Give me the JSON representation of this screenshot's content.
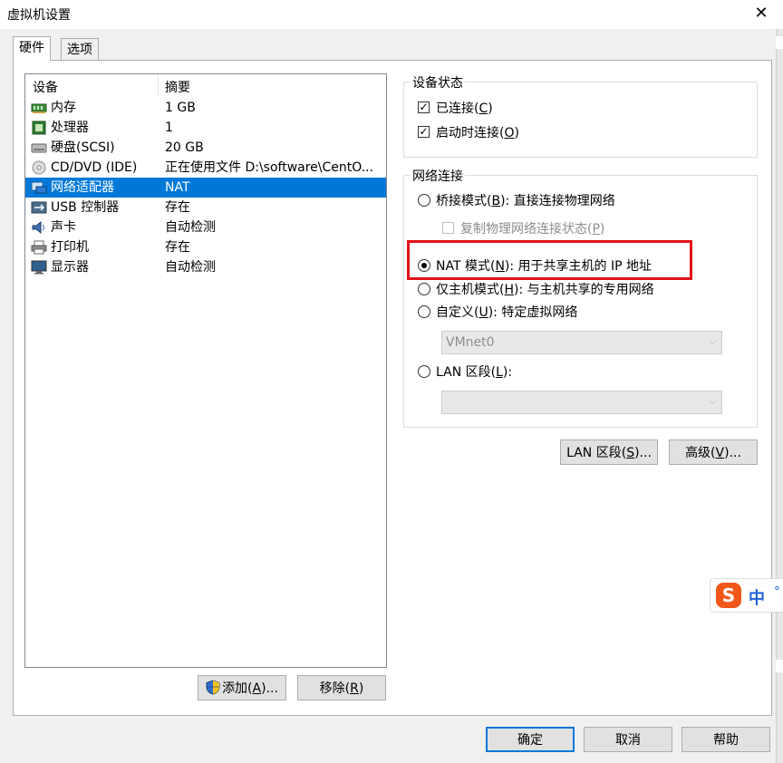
{
  "window": {
    "title": "虚拟机设置",
    "close_glyph": "✕"
  },
  "tabs": [
    {
      "label": "硬件",
      "active": true
    },
    {
      "label": "选项",
      "active": false
    }
  ],
  "device_list": {
    "columns": [
      "设备",
      "摘要"
    ],
    "rows": [
      {
        "icon": "memory-icon",
        "name": "内存",
        "summary": "1 GB",
        "selected": false
      },
      {
        "icon": "processor-icon",
        "name": "处理器",
        "summary": "1",
        "selected": false
      },
      {
        "icon": "hard-disk-icon",
        "name": "硬盘(SCSI)",
        "summary": "20 GB",
        "selected": false
      },
      {
        "icon": "cd-dvd-icon",
        "name": "CD/DVD (IDE)",
        "summary": "正在使用文件 D:\\software\\CentO...",
        "selected": false
      },
      {
        "icon": "network-adapter-icon",
        "name": "网络适配器",
        "summary": "NAT",
        "selected": true
      },
      {
        "icon": "usb-icon",
        "name": "USB 控制器",
        "summary": "存在",
        "selected": false
      },
      {
        "icon": "sound-card-icon",
        "name": "声卡",
        "summary": "自动检测",
        "selected": false
      },
      {
        "icon": "printer-icon",
        "name": "打印机",
        "summary": "存在",
        "selected": false
      },
      {
        "icon": "display-icon",
        "name": "显示器",
        "summary": "自动检测",
        "selected": false
      }
    ]
  },
  "list_buttons": {
    "add": {
      "text": "添加(",
      "key": "A",
      "after": ")..."
    },
    "remove": {
      "text": "移除(",
      "key": "R",
      "after": ")"
    }
  },
  "device_status": {
    "group_label": "设备状态",
    "connected": {
      "text": "已连接(",
      "key": "C",
      "after": ")",
      "checked": true
    },
    "connect_at_power_on": {
      "text": "启动时连接(",
      "key": "O",
      "after": ")",
      "checked": true
    }
  },
  "network_connection": {
    "group_label": "网络连接",
    "bridged": {
      "text": "桥接模式(",
      "key": "B",
      "after": "): 直接连接物理网络",
      "selected": false
    },
    "replicate_state": {
      "text": "复制物理网络连接状态(",
      "key": "P",
      "after": ")",
      "checked": false,
      "disabled": true
    },
    "nat": {
      "text": "NAT 模式(",
      "key": "N",
      "after": "): 用于共享主机的 IP 地址",
      "selected": true
    },
    "host_only": {
      "text": "仅主机模式(",
      "key": "H",
      "after": "): 与主机共享的专用网络",
      "selected": false
    },
    "custom": {
      "text": "自定义(",
      "key": "U",
      "after": "): 特定虚拟网络",
      "selected": false
    },
    "custom_select_value": "VMnet0",
    "lan_segment": {
      "text": "LAN 区段(",
      "key": "L",
      "after": "):",
      "selected": false
    },
    "lan_select_value": ""
  },
  "network_buttons": {
    "lan_segments": {
      "text": "LAN 区段(",
      "key": "S",
      "after": ")..."
    },
    "advanced": {
      "text": "高级(",
      "key": "V",
      "after": ")..."
    }
  },
  "footer_buttons": {
    "ok": "确定",
    "cancel": "取消",
    "help": "帮助"
  },
  "ime": {
    "logo": "S",
    "mode": "中",
    "punct": "°"
  },
  "colors": {
    "selection": "#0078d7",
    "highlight_box": "#e0121a",
    "ime_orange": "#f2571a",
    "ime_blue": "#1f64d6"
  }
}
